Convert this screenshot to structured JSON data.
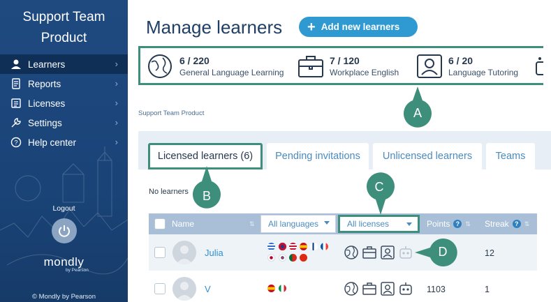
{
  "sidebar": {
    "title_line1": "Support Team",
    "title_line2": "Product",
    "items": [
      {
        "label": "Learners",
        "icon": "user-icon",
        "active": true
      },
      {
        "label": "Reports",
        "icon": "report-icon",
        "active": false
      },
      {
        "label": "Licenses",
        "icon": "license-icon",
        "active": false
      },
      {
        "label": "Settings",
        "icon": "wrench-icon",
        "active": false
      },
      {
        "label": "Help center",
        "icon": "help-icon",
        "active": false
      }
    ],
    "logout_label": "Logout",
    "brand_name": "mondly",
    "brand_sub": "by Pearson",
    "copyright": "© Mondly by Pearson"
  },
  "header": {
    "title": "Manage learners",
    "add_button_label": "Add new learners"
  },
  "products": [
    {
      "count": "6 / 220",
      "name": "General Language Learning",
      "icon": "globe-icon"
    },
    {
      "count": "7 / 120",
      "name": "Workplace English",
      "icon": "briefcase-icon"
    },
    {
      "count": "6 / 20",
      "name": "Language Tutoring",
      "icon": "tutor-icon"
    }
  ],
  "breadcrumb": "Support Team Product",
  "tabs": [
    {
      "label": "Licensed learners (6)",
      "active": true
    },
    {
      "label": "Pending invitations",
      "active": false
    },
    {
      "label": "Unlicensed learners",
      "active": false
    },
    {
      "label": "Teams",
      "active": false
    }
  ],
  "no_learners_text": "No learners",
  "table": {
    "columns": {
      "name": "Name",
      "languages_filter": "All languages",
      "licenses_filter": "All licenses",
      "points": "Points",
      "streak": "Streak"
    },
    "rows": [
      {
        "name": "Julia",
        "points": "",
        "streak": "12",
        "flags": [
          "greece",
          "uk",
          "usa",
          "spain",
          "finland",
          "france",
          "japan",
          "korea",
          "portugal",
          "china"
        ]
      },
      {
        "name": "V",
        "points": "1103",
        "streak": "1",
        "flags": [
          "spain",
          "italy"
        ]
      }
    ]
  },
  "callouts": {
    "a": "A",
    "b": "B",
    "c": "C",
    "d": "D"
  },
  "colors": {
    "sidebar": "#1f4a80",
    "accent": "#2f9ad1",
    "callout": "#3d8f7c",
    "table_header": "#a8bfd7"
  }
}
